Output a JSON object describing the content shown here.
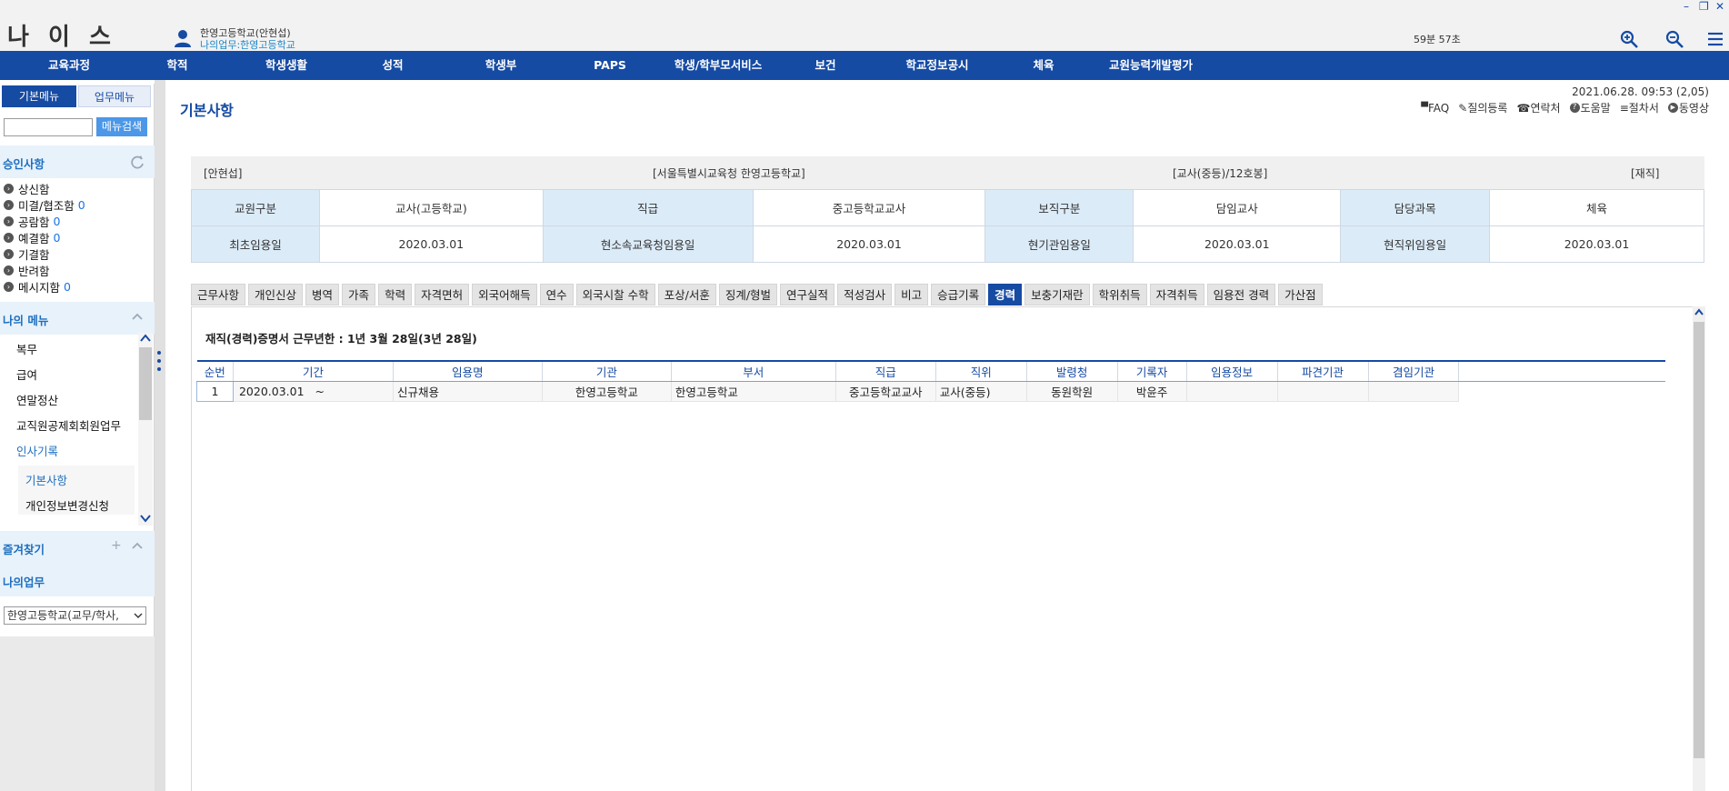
{
  "app": {
    "logo": "나 이 스",
    "user_name": "한영고등학교(안현섭)",
    "user_work": "나의업무:한영고등학교",
    "timer": "59분 57초"
  },
  "window_controls": [
    "–",
    "❐",
    "✕"
  ],
  "main_nav": [
    "교육과정",
    "학적",
    "학생생활",
    "성적",
    "학생부",
    "PAPS",
    "학생/학부모서비스",
    "보건",
    "학교정보공시",
    "체육",
    "교원능력개발평가"
  ],
  "left": {
    "tab_basic": "기본메뉴",
    "tab_work": "업무메뉴",
    "search_placeholder": "",
    "search_button": "메뉴검색",
    "approval_title": "승인사항",
    "approvals": [
      {
        "label": "상신함",
        "count": ""
      },
      {
        "label": "미결/협조함",
        "count": "0"
      },
      {
        "label": "공람함",
        "count": "0"
      },
      {
        "label": "예결함",
        "count": "0"
      },
      {
        "label": "기결함",
        "count": ""
      },
      {
        "label": "반려함",
        "count": ""
      },
      {
        "label": "메시지함",
        "count": "0"
      }
    ],
    "mymenu_title": "나의 메뉴",
    "mymenu_items": [
      "복무",
      "급여",
      "연말정산",
      "교직원공제회회원업무",
      "인사기록"
    ],
    "mymenu_sub": [
      "기본사항",
      "개인정보변경신청"
    ],
    "favorites_title": "즐겨찾기",
    "mywork_title": "나의업무",
    "org_select": "한영고등학교(교무/학사,"
  },
  "content": {
    "page_title": "기본사항",
    "datetime": "2021.06.28. 09:53 (2,05)",
    "tool_links": [
      {
        "icon": "faq-icon",
        "label": "FAQ"
      },
      {
        "icon": "pencil-icon",
        "label": "질의등록"
      },
      {
        "icon": "phone-icon",
        "label": "연락처"
      },
      {
        "icon": "help-icon",
        "label": "도움말"
      },
      {
        "icon": "doc-icon",
        "label": "절차서"
      },
      {
        "icon": "play-icon",
        "label": "동영상"
      }
    ],
    "summary": {
      "name": "[안현섭]",
      "org": "[서울특별시교육청 한영고등학교]",
      "rank": "[교사(중등)/12호봉]",
      "status": "[재직]"
    },
    "info_rows": [
      [
        {
          "label": "교원구분",
          "value": "교사(고등학교)"
        },
        {
          "label": "직급",
          "value": "중고등학교교사"
        },
        {
          "label": "보직구분",
          "value": "담임교사"
        },
        {
          "label": "담당과목",
          "value": "체육"
        }
      ],
      [
        {
          "label": "최초임용일",
          "value": "2020.03.01"
        },
        {
          "label": "현소속교육청임용일",
          "value": "2020.03.01"
        },
        {
          "label": "현기관임용일",
          "value": "2020.03.01"
        },
        {
          "label": "현직위임용일",
          "value": "2020.03.01"
        }
      ]
    ],
    "sub_tabs": [
      "근무사항",
      "개인신상",
      "병역",
      "가족",
      "학력",
      "자격면허",
      "외국어해득",
      "연수",
      "외국시찰 수학",
      "포상/서훈",
      "징계/형벌",
      "연구실적",
      "적성검사",
      "비고",
      "승급기록",
      "경력",
      "보충기재란",
      "학위취득",
      "자격취득",
      "임용전 경력",
      "가산점"
    ],
    "active_sub_tab": "경력",
    "cert_note": "재직(경력)증명서 근무년한 : 1년 3월 28일(3년 28일)",
    "career_headers": [
      "순번",
      "기간",
      "임용명",
      "기관",
      "부서",
      "직급",
      "직위",
      "발령청",
      "기록자",
      "임용정보",
      "파견기관",
      "겸임기관"
    ],
    "career_rows": [
      {
        "seq": "1",
        "period": "2020.03.01   ~",
        "appointment": "신규채용",
        "agency": "한영고등학교",
        "department": "한영고등학교",
        "grade": "중고등학교교사",
        "position": "교사(중등)",
        "issuer": "동원학원",
        "recorder": "박윤주",
        "appoint_info": "",
        "dispatch": "",
        "concurrent": ""
      }
    ]
  },
  "colors": {
    "nav_blue": "#164ba3",
    "label_bg": "#dcebf8",
    "accent_link": "#1e6fbf"
  }
}
